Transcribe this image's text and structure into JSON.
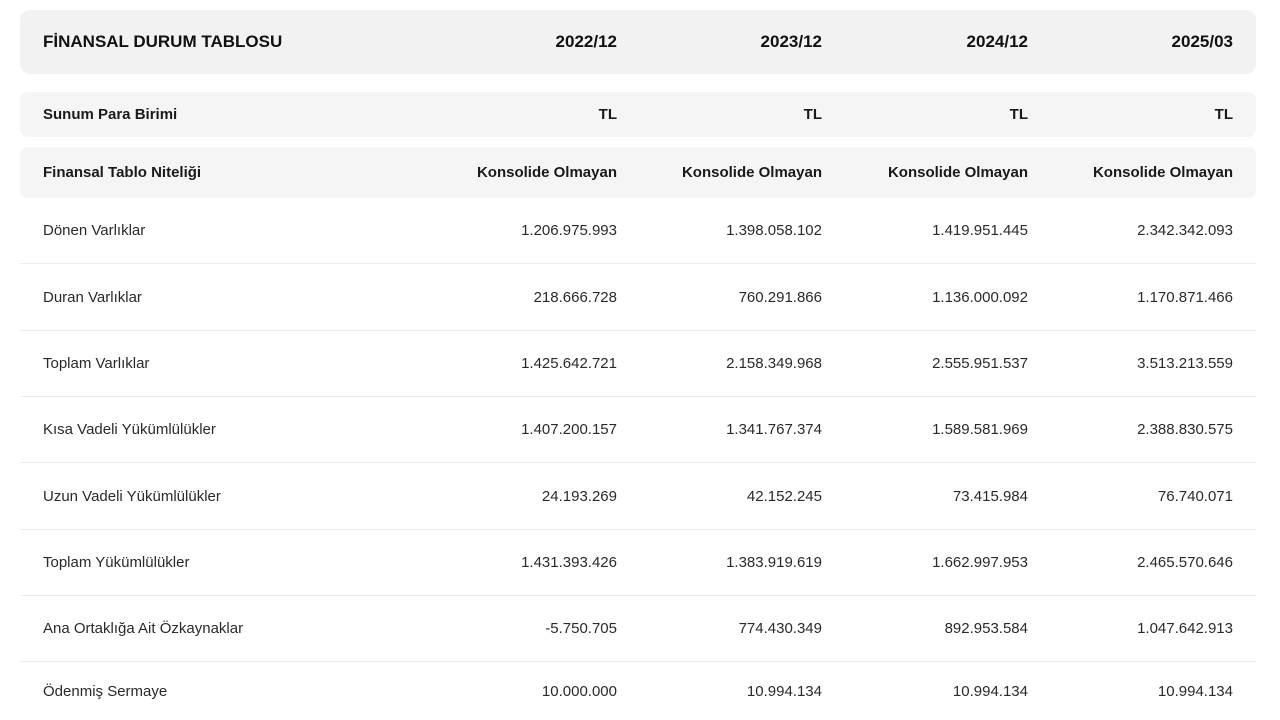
{
  "table": {
    "title": "FİNANSAL DURUM TABLOSU",
    "periods": [
      "2022/12",
      "2023/12",
      "2024/12",
      "2025/03"
    ],
    "currency": {
      "label": "Sunum Para Birimi",
      "values": [
        "TL",
        "TL",
        "TL",
        "TL"
      ]
    },
    "nature": {
      "label": "Finansal Tablo Niteliği",
      "values": [
        "Konsolide Olmayan",
        "Konsolide Olmayan",
        "Konsolide Olmayan",
        "Konsolide Olmayan"
      ]
    },
    "rows": [
      {
        "label": "Dönen Varlıklar",
        "values": [
          "1.206.975.993",
          "1.398.058.102",
          "1.419.951.445",
          "2.342.342.093"
        ]
      },
      {
        "label": "Duran Varlıklar",
        "values": [
          "218.666.728",
          "760.291.866",
          "1.136.000.092",
          "1.170.871.466"
        ]
      },
      {
        "label": "Toplam Varlıklar",
        "values": [
          "1.425.642.721",
          "2.158.349.968",
          "2.555.951.537",
          "3.513.213.559"
        ]
      },
      {
        "label": "Kısa Vadeli Yükümlülükler",
        "values": [
          "1.407.200.157",
          "1.341.767.374",
          "1.589.581.969",
          "2.388.830.575"
        ]
      },
      {
        "label": "Uzun Vadeli Yükümlülükler",
        "values": [
          "24.193.269",
          "42.152.245",
          "73.415.984",
          "76.740.071"
        ]
      },
      {
        "label": "Toplam Yükümlülükler",
        "values": [
          "1.431.393.426",
          "1.383.919.619",
          "1.662.997.953",
          "2.465.570.646"
        ]
      },
      {
        "label": "Ana Ortaklığa Ait Özkaynaklar",
        "values": [
          "-5.750.705",
          "774.430.349",
          "892.953.584",
          "1.047.642.913"
        ]
      },
      {
        "label": "Ödenmiş Sermaye",
        "values": [
          "10.000.000",
          "10.994.134",
          "10.994.134",
          "10.994.134"
        ]
      }
    ]
  }
}
